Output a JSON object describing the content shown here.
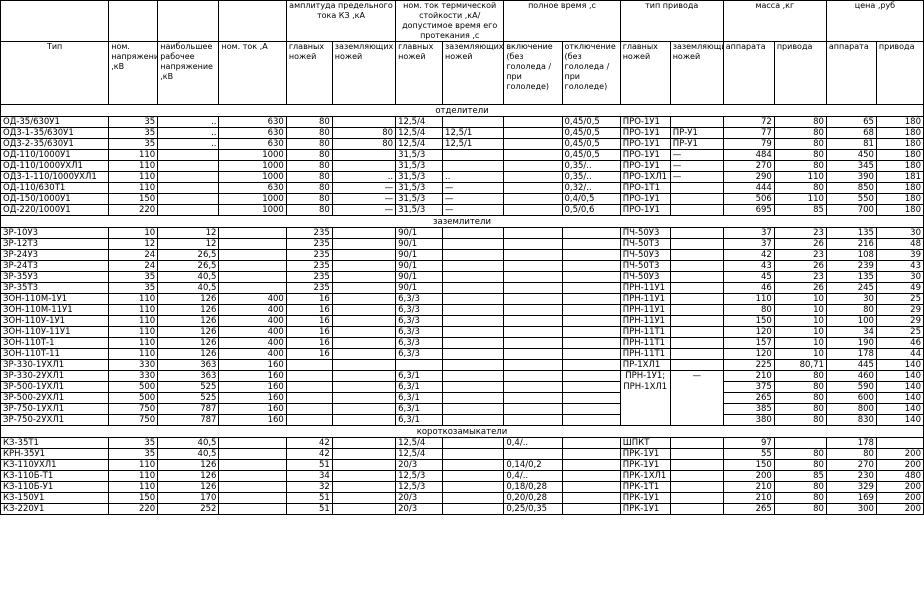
{
  "headers": {
    "group": {
      "current": "амплитуда предельного тока КЗ ,кА",
      "thermal": "ном. ток термической стойкости ,кА/допустимое время его протекания ,с",
      "time": "полное время ,с",
      "drive": "тип привода",
      "mass": "масса ,кг",
      "price": "цена ,руб"
    },
    "cols": {
      "type": "Тип",
      "voltage": "ном. напряжение ,кВ",
      "max_voltage": "наибольшее рабочее напряжение ,кВ",
      "nom_current": "ном. ток ,А",
      "main_knives": "главных ножей",
      "ground_knives": "заземляющих ножей",
      "th_main": "главных ножей",
      "th_ground": "заземляющих ножей",
      "on_time": "включение (без гололеда / при гололеде)",
      "off_time": "отключение (без гололеда / при гололеде)",
      "drive_main": "главных ножей",
      "drive_ground": "заземляющих ножей",
      "mass_app": "аппарата",
      "mass_drive": "привода",
      "price_app": "аппарата",
      "price_drive": "привода"
    }
  },
  "sections": [
    {
      "title": "отделители",
      "rows": [
        [
          "ОД-35/630У1",
          "35",
          "..",
          "630",
          "80",
          "",
          "12,5/4",
          "",
          "",
          "0,45/0,5",
          "ПРО-1У1",
          "",
          "72",
          "80",
          "65",
          "180"
        ],
        [
          "ОД3-1-35/630У1",
          "35",
          "..",
          "630",
          "80",
          "80",
          "12,5/4",
          "12,5/1",
          "",
          "0,45/0,5",
          "ПРО-1У1",
          "ПР-У1",
          "77",
          "80",
          "68",
          "180"
        ],
        [
          "ОД3-2-35/630У1",
          "35",
          "..",
          "630",
          "80",
          "80",
          "12,5/4",
          "12,5/1",
          "",
          "0,45/0,5",
          "ПРО-1У1",
          "ПР-У1",
          "79",
          "80",
          "81",
          "180"
        ],
        [
          "ОД-110/1000У1",
          "110",
          "",
          "1000",
          "80",
          "",
          "31,5/3",
          "",
          "",
          "0,45/0,5",
          "ПРО-1У1",
          "—",
          "484",
          "80",
          "450",
          "180"
        ],
        [
          "ОД-110/1000УХЛ1",
          "110",
          "",
          "1000",
          "80",
          "",
          "31,5/3",
          "",
          "",
          "0,35/..",
          "ПРО-1У1",
          "—",
          "270",
          "80",
          "345",
          "180"
        ],
        [
          "ОД3-1-110/1000УХЛ1",
          "110",
          "",
          "1000",
          "80",
          "..",
          "31,5/3",
          "..",
          "",
          "0,35/..",
          "ПРО-1ХЛ1",
          "—",
          "290",
          "110",
          "390",
          "181"
        ],
        [
          "ОД-110/630Т1",
          "110",
          "",
          "630",
          "80",
          "—",
          "31,5/3",
          "—",
          "",
          "0,32/..",
          "ПРО-1Т1",
          "",
          "444",
          "80",
          "850",
          "180"
        ],
        [
          "ОД-150/1000У1",
          "150",
          "",
          "1000",
          "80",
          "—",
          "31,5/3",
          "—",
          "",
          "0,4/0,5",
          "ПРО-1У1",
          "",
          "506",
          "110",
          "550",
          "180"
        ],
        [
          "ОД-220/1000У1",
          "220",
          "",
          "1000",
          "80",
          "—",
          "31,5/3",
          "—",
          "",
          "0,5/0,6",
          "ПРО-1У1",
          "",
          "695",
          "85",
          "700",
          "180"
        ]
      ]
    },
    {
      "title": "заземлители",
      "rows": [
        [
          "ЗР-10У3",
          "10",
          "12",
          "",
          "235",
          "",
          "90/1",
          "",
          "",
          "",
          "ПЧ-50У3",
          "",
          "37",
          "23",
          "135",
          "30"
        ],
        [
          "ЗР-12Т3",
          "12",
          "12",
          "",
          "235",
          "",
          "90/1",
          "",
          "",
          "",
          "ПЧ-50Т3",
          "",
          "37",
          "26",
          "216",
          "48"
        ],
        [
          "ЗР-24У3",
          "24",
          "26,5",
          "",
          "235",
          "",
          "90/1",
          "",
          "",
          "",
          "ПЧ-50У3",
          "",
          "42",
          "23",
          "108",
          "39"
        ],
        [
          "ЗР-24Т3",
          "24",
          "26,5",
          "",
          "235",
          "",
          "90/1",
          "",
          "",
          "",
          "ПЧ-50Т3",
          "",
          "43",
          "26",
          "239",
          "43"
        ],
        [
          "ЗР-35У3",
          "35",
          "40,5",
          "",
          "235",
          "",
          "90/1",
          "",
          "",
          "",
          "ПЧ-50У3",
          "",
          "45",
          "23",
          "135",
          "30"
        ],
        [
          "ЗР-35Т3",
          "35",
          "40,5",
          "",
          "235",
          "",
          "90/1",
          "",
          "",
          "",
          "ПРН-11У1",
          "",
          "46",
          "26",
          "245",
          "49"
        ],
        [
          "ЗОН-110М-1У1",
          "110",
          "126",
          "400",
          "16",
          "",
          "6,3/3",
          "",
          "",
          "",
          "ПРН-11У1",
          "",
          "110",
          "10",
          "30",
          "25"
        ],
        [
          "ЗОН-110М-11У1",
          "110",
          "126",
          "400",
          "16",
          "",
          "6,3/3",
          "",
          "",
          "",
          "ПРН-11У1",
          "",
          "80",
          "10",
          "80",
          "29"
        ],
        [
          "ЗОН-110У-1У1",
          "110",
          "126",
          "400",
          "16",
          "",
          "6,3/3",
          "",
          "",
          "",
          "ПРН-11У1",
          "",
          "150",
          "10",
          "100",
          "29"
        ],
        [
          "ЗОН-110У-11У1",
          "110",
          "126",
          "400",
          "16",
          "",
          "6,3/3",
          "",
          "",
          "",
          "ПРН-11Т1",
          "",
          "120",
          "10",
          "34",
          "25"
        ],
        [
          "ЗОН-110Т-1",
          "110",
          "126",
          "400",
          "16",
          "",
          "6,3/3",
          "",
          "",
          "",
          "ПРН-11Т1",
          "",
          "157",
          "10",
          "190",
          "46"
        ],
        [
          "ЗОН-110Т-11",
          "110",
          "126",
          "400",
          "16",
          "",
          "6,3/3",
          "",
          "",
          "",
          "ПРН-11Т1",
          "",
          "120",
          "10",
          "178",
          "44"
        ],
        [
          "ЗР-330-1УХЛ1",
          "330",
          "363",
          "160",
          "",
          "",
          "",
          "",
          "",
          "",
          "ПР-1ХЛ1",
          "",
          "225",
          "80,71",
          "445",
          "140"
        ],
        [
          "ЗР-330-2УХЛ1",
          "330",
          "363",
          "160",
          "",
          "",
          "6,3/1",
          "",
          "",
          "",
          "",
          "",
          "210",
          "80",
          "460",
          "140"
        ],
        [
          "ЗР-500-1УХЛ1",
          "500",
          "525",
          "160",
          "",
          "",
          "6,3/1",
          "",
          "",
          "",
          "",
          "",
          "375",
          "80",
          "590",
          "140"
        ],
        [
          "ЗР-500-2УХЛ1",
          "500",
          "525",
          "160",
          "",
          "",
          "6,3/1",
          "",
          "",
          "",
          "",
          "",
          "265",
          "80",
          "600",
          "140"
        ],
        [
          "ЗР-750-1УХЛ1",
          "750",
          "787",
          "160",
          "",
          "",
          "6,3/1",
          "",
          "",
          "",
          "",
          "",
          "385",
          "80",
          "800",
          "140"
        ],
        [
          "ЗР-750-2УХЛ1",
          "750",
          "787",
          "160",
          "",
          "",
          "6,3/1",
          "",
          "",
          "",
          "",
          "",
          "380",
          "80",
          "830",
          "140"
        ]
      ]
    },
    {
      "title": "короткозамыкатели",
      "rows": [
        [
          "КЗ-35Т1",
          "35",
          "40,5",
          "",
          "42",
          "",
          "12,5/4",
          "",
          "0,4/..",
          "",
          "ШПКТ",
          "",
          "97",
          "",
          "178",
          ""
        ],
        [
          "КРН-35У1",
          "35",
          "40,5",
          "",
          "42",
          "",
          "12,5/4",
          "",
          "",
          "",
          "ПРК-1У1",
          "",
          "55",
          "80",
          "80",
          "200"
        ],
        [
          "КЗ-110УХЛ1",
          "110",
          "126",
          "",
          "51",
          "",
          "20/3",
          "",
          "0,14/0,2",
          "",
          "ПРК-1У1",
          "",
          "150",
          "80",
          "270",
          "200"
        ],
        [
          "КЗ-110Б-Т1",
          "110",
          "126",
          "",
          "34",
          "",
          "12,5/3",
          "",
          "0,4/..",
          "",
          "ПРК-1ХЛ1",
          "",
          "200",
          "85",
          "230",
          "480"
        ],
        [
          "КЗ-110Б-У1",
          "110",
          "126",
          "",
          "32",
          "",
          "12,5/3",
          "",
          "0,18/0,28",
          "",
          "ПРК-1Т1",
          "",
          "210",
          "80",
          "329",
          "200"
        ],
        [
          "КЗ-150У1",
          "150",
          "170",
          "",
          "51",
          "",
          "20/3",
          "",
          "0,20/0,28",
          "",
          "ПРК-1У1",
          "",
          "210",
          "80",
          "169",
          "200"
        ],
        [
          "КЗ-220У1",
          "220",
          "252",
          "",
          "51",
          "",
          "20/3",
          "",
          "0,25/0,35",
          "",
          "ПРК-1У1",
          "",
          "265",
          "80",
          "300",
          "200"
        ]
      ]
    }
  ],
  "merged_drive": "ПРН-1У1; ПРН-1ХЛ1",
  "merged_drive_ground": "—"
}
